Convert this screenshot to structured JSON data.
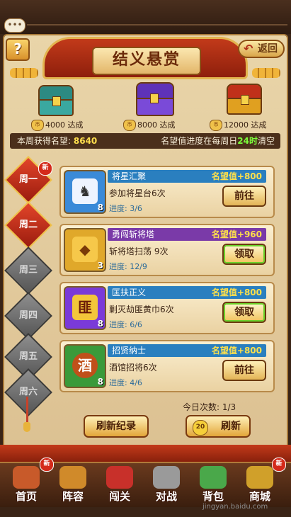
{
  "chat": {
    "icon": "chat-bubble-icon",
    "dots": "•••"
  },
  "header": {
    "title": "结义悬赏",
    "help_label": "?",
    "back_label": "返回"
  },
  "chests": [
    {
      "amount": "4000",
      "suffix": "达成",
      "color": "#3aa8a0"
    },
    {
      "amount": "8000",
      "suffix": "达成",
      "color": "#7a4ad8"
    },
    {
      "amount": "12000",
      "suffix": "达成",
      "color": "#e0a020"
    }
  ],
  "info": {
    "fame_label": "本周获得名望:",
    "fame_value": "8640",
    "reset_pre": "名望值进度在每周日",
    "reset_time": "24时",
    "reset_post": "清空"
  },
  "days": [
    {
      "label": "周一",
      "active": true,
      "new": true
    },
    {
      "label": "周二",
      "active": true,
      "new": false
    },
    {
      "label": "周三",
      "active": false,
      "new": false
    },
    {
      "label": "周四",
      "active": false,
      "new": false
    },
    {
      "label": "周五",
      "active": false,
      "new": false
    },
    {
      "label": "周六",
      "active": false,
      "new": false
    }
  ],
  "new_badge": "新",
  "quests": [
    {
      "name": "将星汇聚",
      "reward": "名望值+800",
      "desc": "参加将星台6次",
      "progress": "进度: 3/6",
      "button": "前往",
      "icon_count": "8",
      "title_color": "#2a7fbf",
      "icon_bg": "#3a8ad8",
      "glyph": "♞"
    },
    {
      "name": "勇闯斩将塔",
      "reward": "名望值+960",
      "desc": "斩将塔扫荡 9次",
      "progress": "进度: 12/9",
      "button": "领取",
      "icon_count": "3",
      "title_color": "#7a3aa8",
      "icon_bg": "#e0a82a",
      "glyph": "◆"
    },
    {
      "name": "匡扶正义",
      "reward": "名望值+800",
      "desc": "剿灭劫匪黄巾6次",
      "progress": "进度: 6/6",
      "button": "领取",
      "icon_count": "8",
      "title_color": "#2a7fbf",
      "icon_bg": "#7a3ad8",
      "glyph": "匪"
    },
    {
      "name": "招贤纳士",
      "reward": "名望值+800",
      "desc": "酒馆招将6次",
      "progress": "进度: 4/6",
      "button": "前往",
      "icon_count": "8",
      "title_color": "#2a7fbf",
      "icon_bg": "#3a9a3a",
      "glyph": "酒"
    }
  ],
  "today": {
    "label": "今日次数:",
    "value": "1/3"
  },
  "buttons": {
    "refresh_log": "刷新纪录",
    "refresh_cost": "20",
    "refresh": "刷新"
  },
  "nav": [
    {
      "label": "首页",
      "icon": "home-icon",
      "new": true,
      "color": "#c85a2a"
    },
    {
      "label": "阵容",
      "icon": "lineup-icon",
      "new": false,
      "color": "#d08a2a"
    },
    {
      "label": "闯关",
      "icon": "stage-icon",
      "new": false,
      "color": "#c8302a"
    },
    {
      "label": "对战",
      "icon": "battle-icon",
      "new": false,
      "color": "#9a9a9a"
    },
    {
      "label": "背包",
      "icon": "bag-icon",
      "new": false,
      "color": "#4aa84a"
    },
    {
      "label": "商城",
      "icon": "shop-icon",
      "new": true,
      "color": "#d0a02a"
    }
  ],
  "watermark": "jingyan.baidu.com"
}
